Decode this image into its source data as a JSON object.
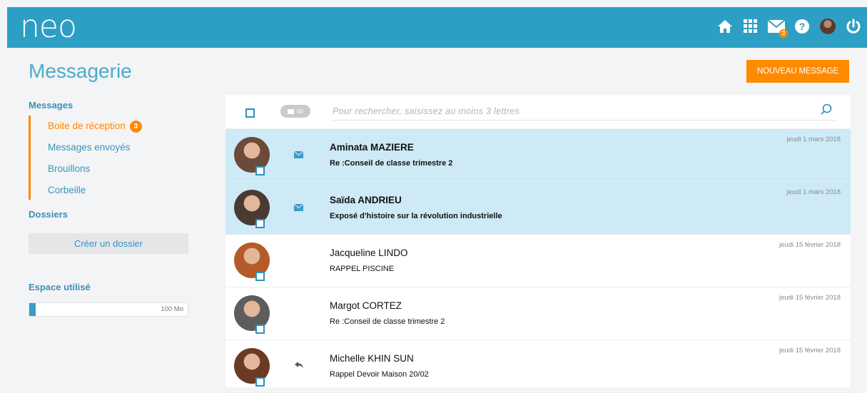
{
  "app": {
    "logo": "neo"
  },
  "header_icons": [
    {
      "name": "home-icon"
    },
    {
      "name": "apps-grid-icon"
    },
    {
      "name": "mail-icon",
      "badge": "3"
    },
    {
      "name": "help-icon"
    },
    {
      "name": "user-avatar"
    },
    {
      "name": "power-icon"
    }
  ],
  "page": {
    "title": "Messagerie",
    "new_message_label": "NOUVEAU MESSAGE"
  },
  "sidebar": {
    "messages_heading": "Messages",
    "items": [
      {
        "label": "Boite de réception",
        "count": "3"
      },
      {
        "label": "Messages envoyés"
      },
      {
        "label": "Brouillons"
      },
      {
        "label": "Corbeille"
      }
    ],
    "folders_heading": "Dossiers",
    "create_folder_label": "Créer un dossier",
    "storage_heading": "Espace utilisé",
    "storage_label": "100 Mo",
    "storage_fraction": 0.04
  },
  "toolbar": {
    "toggle_label": "00",
    "search_placeholder": "Pour rechercher, saisissez au moins 3 lettres"
  },
  "messages": [
    {
      "sender": "Aminata MAZIERE",
      "subject": "Re :Conseil de classe trimestre 2",
      "date": "jeudi 1 mars 2018",
      "unread": true,
      "status_icon": "envelope-icon",
      "avatar_color": "#6b4a3a"
    },
    {
      "sender": "Saïda ANDRIEU",
      "subject": "Exposé d'histoire sur la révolution industrielle",
      "date": "jeudi 1 mars 2018",
      "unread": true,
      "status_icon": "envelope-icon",
      "avatar_color": "#4a3b32"
    },
    {
      "sender": "Jacqueline LINDO",
      "subject": "RAPPEL PISCINE",
      "date": "jeudi 15 février 2018",
      "unread": false,
      "status_icon": "",
      "avatar_color": "#b65a2a"
    },
    {
      "sender": "Margot CORTEZ",
      "subject": "Re :Conseil de classe trimestre 2",
      "date": "jeudi 15 février 2018",
      "unread": false,
      "status_icon": "",
      "avatar_color": "#5d5d5d"
    },
    {
      "sender": "Michelle KHIN SUN",
      "subject": "Rappel Devoir Maison 20/02",
      "date": "jeudi 15 février 2018",
      "unread": false,
      "status_icon": "reply-icon",
      "avatar_color": "#6a3a22"
    }
  ]
}
